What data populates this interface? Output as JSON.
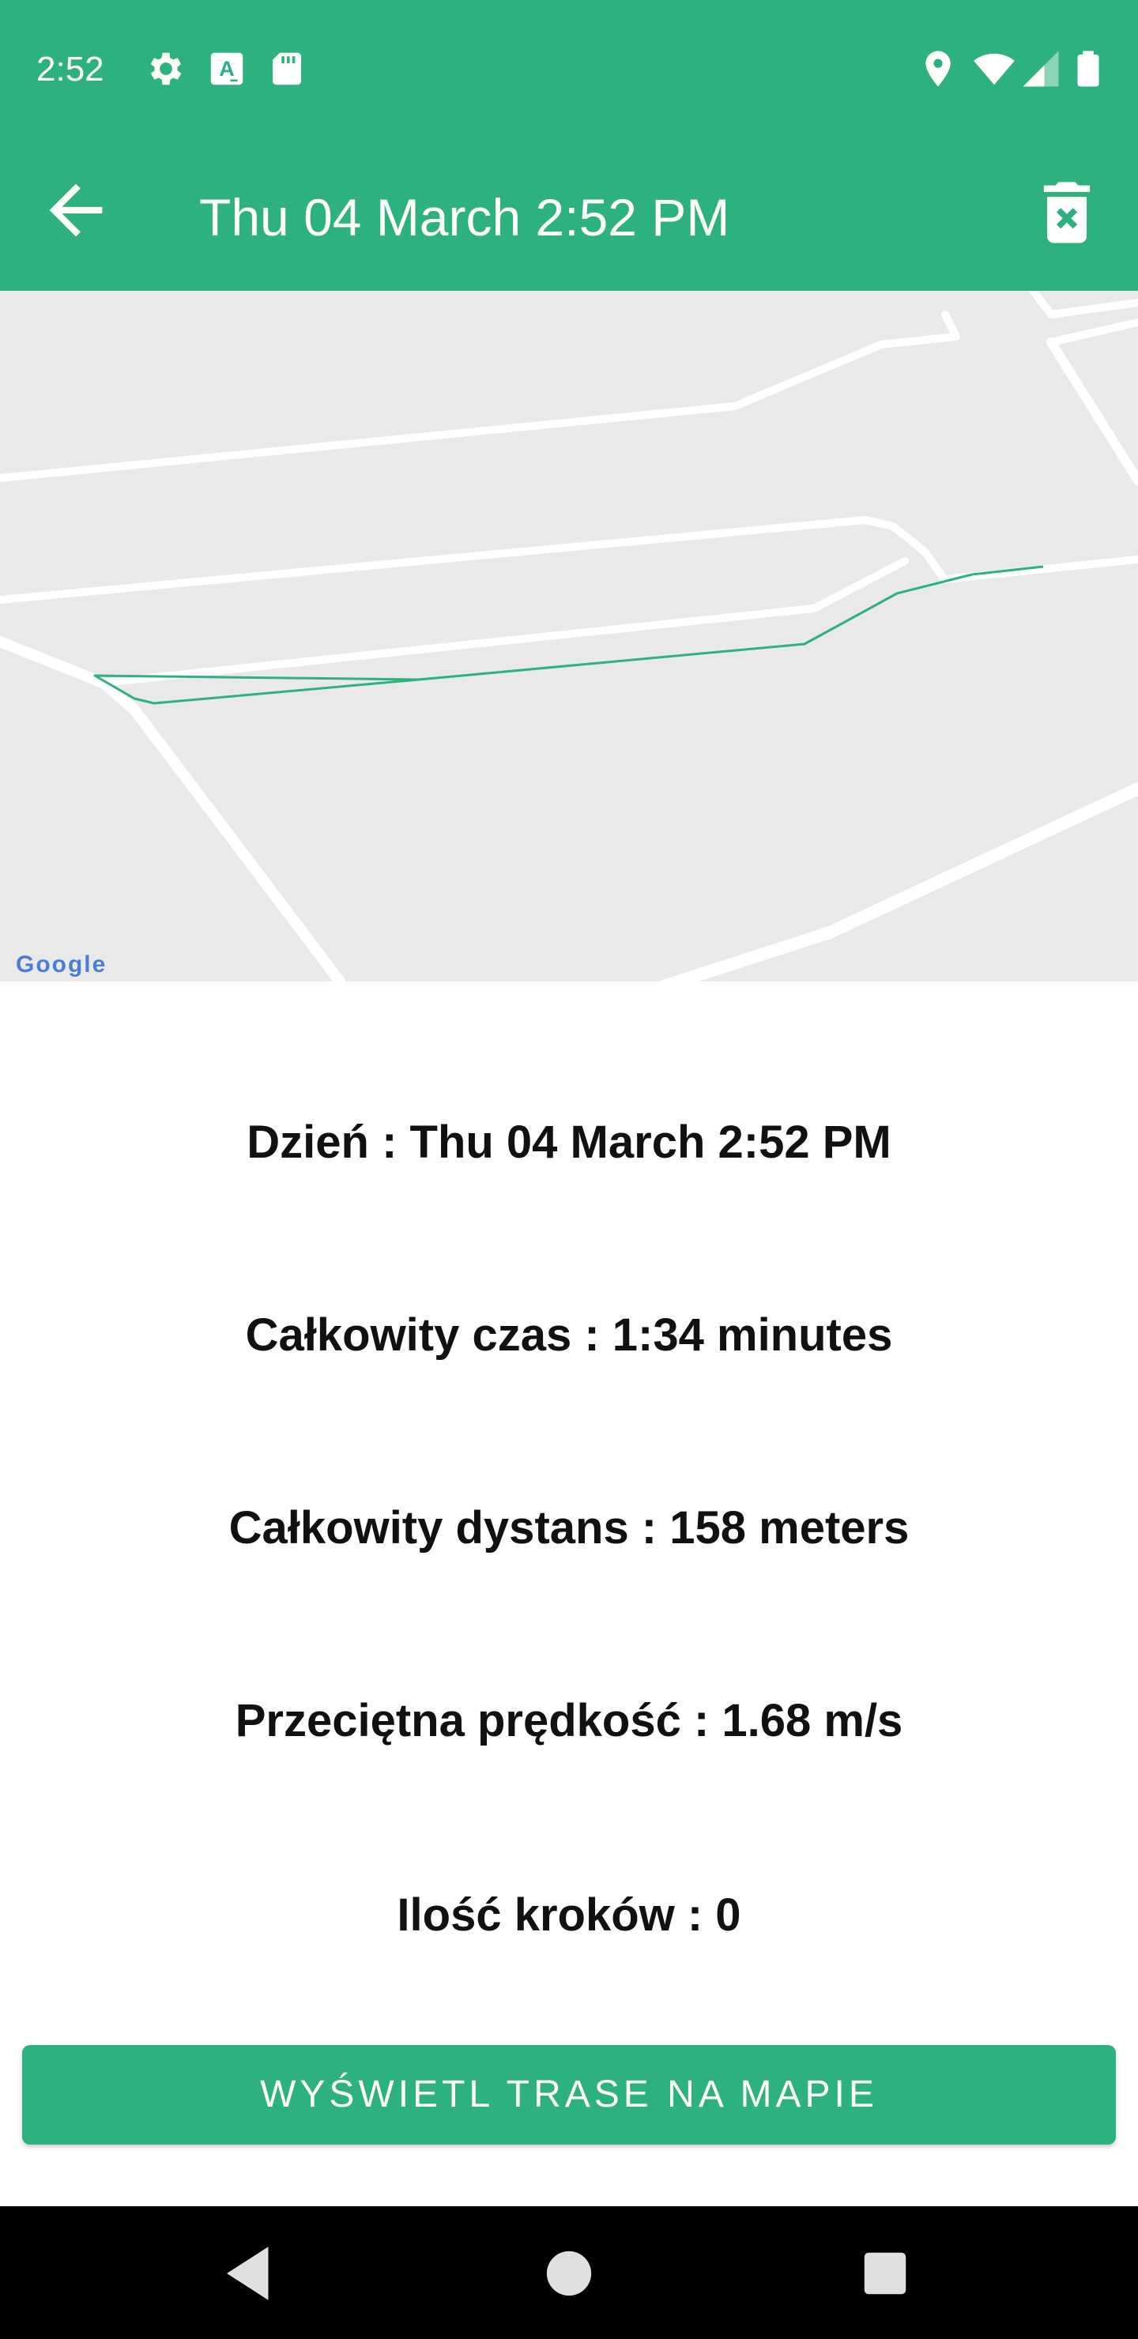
{
  "status_bar": {
    "time": "2:52",
    "left_icons": [
      "gear-icon",
      "keyboard-a-icon",
      "sd-card-icon"
    ],
    "right_icons": [
      "location-icon",
      "wifi-icon",
      "signal-icon",
      "battery-icon"
    ]
  },
  "app_bar": {
    "title": "Thu 04 March 2:52 PM",
    "back_icon": "arrow-back-icon",
    "delete_icon": "trash-icon"
  },
  "map": {
    "provider_logo": "Google",
    "route_color": "#2db17e"
  },
  "info": {
    "day": "Dzień : Thu 04 March 2:52 PM",
    "total_time": "Całkowity czas : 1:34 minutes",
    "total_distance": "Całkowity dystans : 158 meters",
    "average_speed": "Przeciętna prędkość : 1.68 m/s",
    "steps": "Ilość kroków : 0"
  },
  "actions": {
    "show_route_label": "WYŚWIETL TRASE NA MAPIE"
  },
  "colors": {
    "primary": "#2db17e",
    "map_background": "#e9e9e9",
    "text": "#111111"
  }
}
